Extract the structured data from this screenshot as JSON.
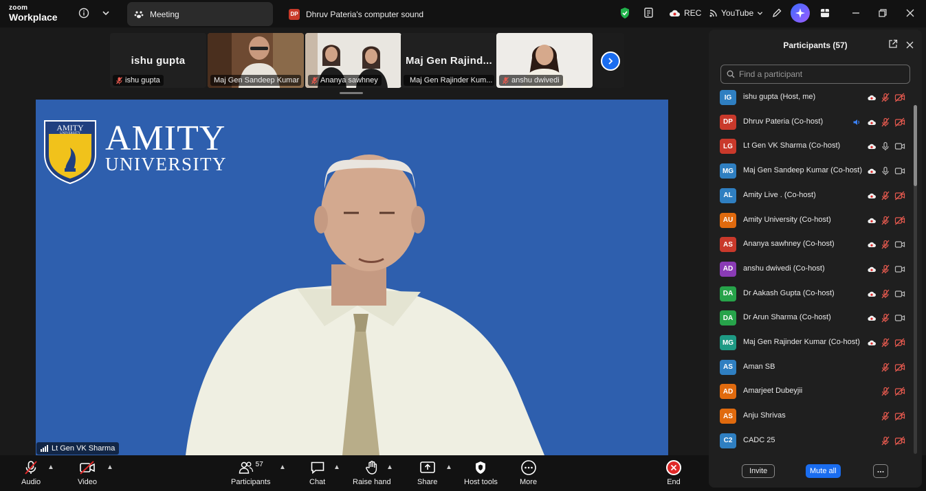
{
  "app": {
    "logo_line1": "zoom",
    "logo_line2": "Workplace"
  },
  "tabs": [
    {
      "label": "Meeting"
    },
    {
      "label": "Dhruv Pateria's computer sound",
      "badge": "DP"
    }
  ],
  "topbar": {
    "rec_label": "REC",
    "youtube_label": "YouTube"
  },
  "strip": {
    "tiles": [
      {
        "big_name": "ishu gupta",
        "name": "ishu gupta"
      },
      {
        "name": "Maj Gen Sandeep Kumar"
      },
      {
        "name": "Ananya sawhney"
      },
      {
        "big_name": "Maj Gen Rajind...",
        "name": "Maj Gen Rajinder Kum..."
      },
      {
        "name": "anshu dwivedi"
      }
    ]
  },
  "stage": {
    "speaker_name": "Lt Gen VK Sharma",
    "logo_big": "AMITY",
    "logo_small": "UNIVERSITY",
    "shield_line1": "AMITY",
    "shield_line2": "UNIVERSITY"
  },
  "toolbar": {
    "audio": "Audio",
    "video": "Video",
    "participants": "Participants",
    "participants_count": "57",
    "chat": "Chat",
    "raise_hand": "Raise hand",
    "share": "Share",
    "host_tools": "Host tools",
    "more": "More",
    "end": "End"
  },
  "panel": {
    "title": "Participants (57)",
    "search_placeholder": "Find a participant",
    "invite": "Invite",
    "mute_all": "Mute all",
    "participants": [
      {
        "initials": "IG",
        "name": "ishu gupta (Host, me)",
        "color": "#2f7fc1",
        "cloud": true,
        "mic": "off",
        "cam": "off",
        "speaking": false
      },
      {
        "initials": "DP",
        "name": "Dhruv Pateria (Co-host)",
        "color": "#c9392b",
        "cloud": true,
        "mic": "off",
        "cam": "off",
        "speaking": true
      },
      {
        "initials": "LG",
        "name": "Lt Gen VK Sharma (Co-host)",
        "color": "#c9392b",
        "cloud": true,
        "mic": "on",
        "cam": "on",
        "speaking": false
      },
      {
        "initials": "MG",
        "name": "Maj Gen Sandeep Kumar (Co-host)",
        "color": "#2f7fc1",
        "cloud": true,
        "mic": "on",
        "cam": "on",
        "speaking": false
      },
      {
        "initials": "AL",
        "name": "Amity Live . (Co-host)",
        "color": "#2f7fc1",
        "cloud": true,
        "mic": "off",
        "cam": "off",
        "speaking": false
      },
      {
        "initials": "AU",
        "name": "Amity University (Co-host)",
        "color": "#e06a0e",
        "cloud": true,
        "mic": "off",
        "cam": "off",
        "speaking": false
      },
      {
        "initials": "AS",
        "name": "Ananya sawhney (Co-host)",
        "color": "#c9392b",
        "cloud": true,
        "mic": "off",
        "cam": "on",
        "speaking": false
      },
      {
        "initials": "AD",
        "name": "anshu dwivedi (Co-host)",
        "color": "#8a3bb5",
        "cloud": true,
        "mic": "off",
        "cam": "on",
        "speaking": false
      },
      {
        "initials": "DA",
        "name": "Dr Aakash Gupta (Co-host)",
        "color": "#27a34a",
        "cloud": true,
        "mic": "off",
        "cam": "on",
        "speaking": false
      },
      {
        "initials": "DA",
        "name": "Dr Arun Sharma (Co-host)",
        "color": "#27a34a",
        "cloud": true,
        "mic": "off",
        "cam": "on",
        "speaking": false
      },
      {
        "initials": "MG",
        "name": "Maj Gen Rajinder Kumar (Co-host)",
        "color": "#1e9a84",
        "cloud": true,
        "mic": "off",
        "cam": "off",
        "speaking": false
      },
      {
        "initials": "AS",
        "name": "Aman SB",
        "color": "#2f7fc1",
        "cloud": false,
        "mic": "off",
        "cam": "off",
        "speaking": false
      },
      {
        "initials": "AD",
        "name": "Amarjeet Dubeyjii",
        "color": "#e06a0e",
        "cloud": false,
        "mic": "off",
        "cam": "off",
        "speaking": false
      },
      {
        "initials": "AS",
        "name": "Anju Shrivas",
        "color": "#e06a0e",
        "cloud": false,
        "mic": "off",
        "cam": "off",
        "speaking": false
      },
      {
        "initials": "C2",
        "name": "CADC 25",
        "color": "#2f7fc1",
        "cloud": false,
        "mic": "off",
        "cam": "off",
        "speaking": false
      }
    ]
  },
  "colors": {
    "accent": "#1a6df0",
    "stage_bg": "#2e5fae",
    "danger": "#e02828",
    "shield_bg": "#f1c21b"
  }
}
